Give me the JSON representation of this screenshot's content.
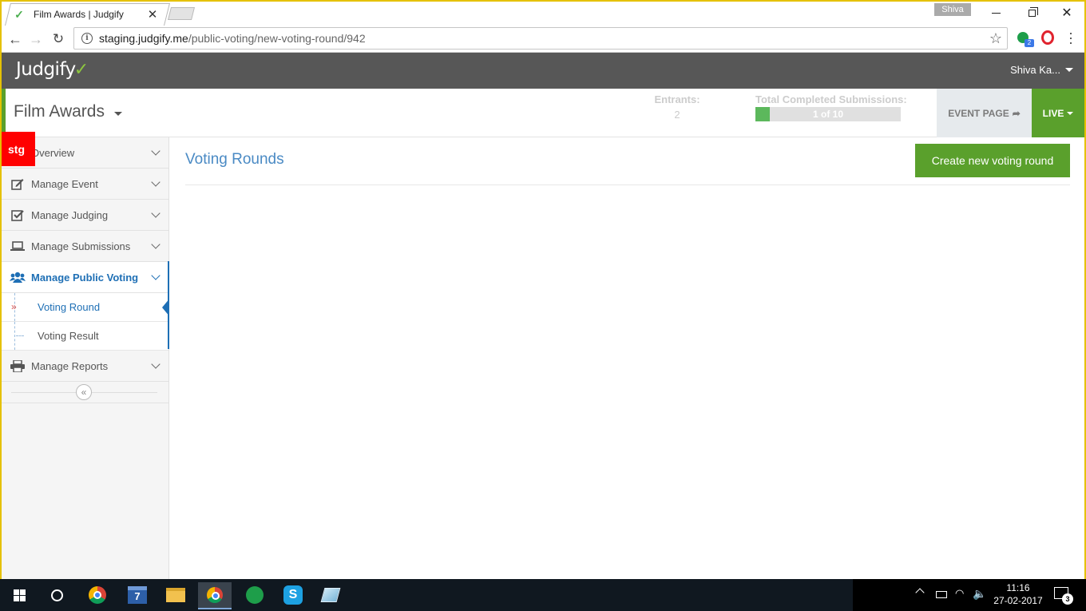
{
  "browser": {
    "tab_title": "Film Awards | Judgify",
    "profile_name": "Shiva",
    "url_host": "staging.judgify.me",
    "url_path": "/public-voting/new-voting-round/942",
    "extension_badge": "2"
  },
  "app": {
    "logo_text": "Judgify",
    "user_name": "Shiva Ka...",
    "brand_green": "#5aa02c",
    "header_gray": "#575757",
    "link_blue": "#1e6fb5"
  },
  "event": {
    "title": "Film Awards",
    "entrants_label": "Entrants:",
    "entrants_value": "2",
    "submissions_label": "Total Completed Submissions:",
    "submissions_text": "1 of 10",
    "submissions_fraction": 0.1,
    "event_page_label": "EVENT PAGE",
    "live_label": "LIVE"
  },
  "env_badge": "stg",
  "sidebar": {
    "items": [
      {
        "label": "Overview",
        "icon": "dashboard-icon"
      },
      {
        "label": "Manage Event",
        "icon": "edit-icon"
      },
      {
        "label": "Manage Judging",
        "icon": "checkbox-icon"
      },
      {
        "label": "Manage Submissions",
        "icon": "laptop-icon"
      },
      {
        "label": "Manage Public Voting",
        "icon": "users-icon",
        "active": true
      },
      {
        "label": "Manage Reports",
        "icon": "print-icon"
      }
    ],
    "sub_items": [
      {
        "label": "Voting Round",
        "selected": true
      },
      {
        "label": "Voting Result",
        "selected": false
      }
    ],
    "collapse_glyph": "«"
  },
  "main": {
    "title": "Voting Rounds",
    "create_button": "Create new voting round"
  },
  "taskbar": {
    "calendar_day": "7",
    "time": "11:16",
    "date": "27-02-2017",
    "notification_count": "3"
  }
}
